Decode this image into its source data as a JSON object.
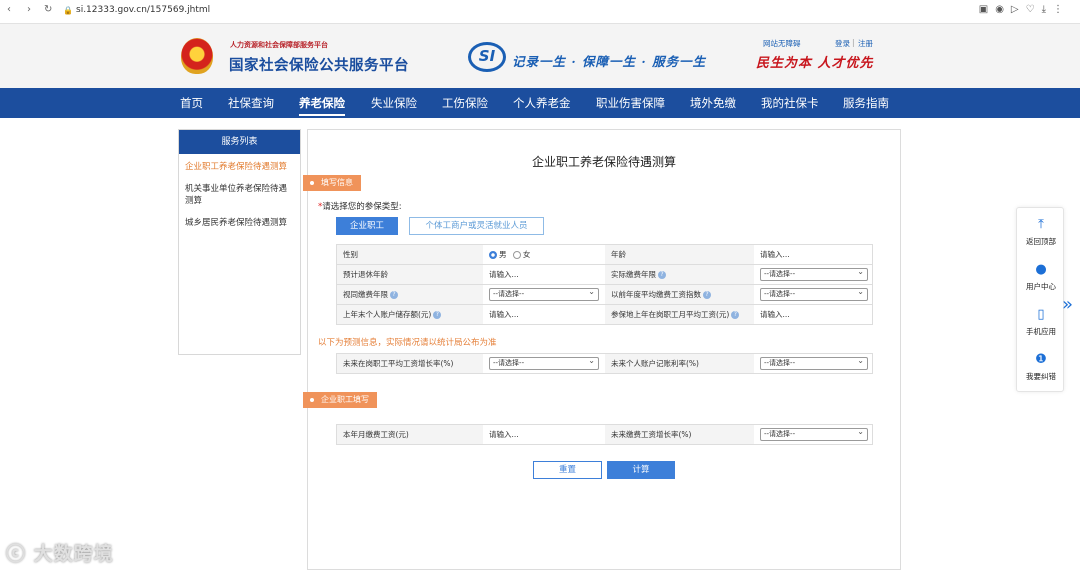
{
  "browser": {
    "url": "si.12333.gov.cn/157569.jhtml"
  },
  "header": {
    "org_sub": "人力资源和社会保障部服务平台",
    "org_main": "国家社会保险公共服务平台",
    "logo_text": "SI",
    "slogan": "记录一生 · 保障一生 · 服务一生",
    "accessibility": "网站无障碍",
    "login": "登录",
    "register": "注册",
    "calligraphy": "民生为本 人才优先"
  },
  "nav": [
    "首页",
    "社保查询",
    "养老保险",
    "失业保险",
    "工伤保险",
    "个人养老金",
    "职业伤害保障",
    "境外免缴",
    "我的社保卡",
    "服务指南"
  ],
  "sidebar": {
    "title": "服务列表",
    "items": [
      "企业职工养老保险待遇测算",
      "机关事业单位养老保险待遇测算",
      "城乡居民养老保险待遇测算"
    ]
  },
  "page": {
    "title": "企业职工养老保险待遇测算",
    "tag_fill": "填写信息",
    "choose_label": "请选择您的参保类型:",
    "type_buttons": [
      "企业职工",
      "个体工商户或灵活就业人员"
    ],
    "note": "以下为预测信息，实际情况请以统计局公布为准",
    "tag_enterprise": "企业职工填写",
    "reset": "重置",
    "calc": "计算"
  },
  "form": {
    "gender": "性别",
    "male": "男",
    "female": "女",
    "age": "年龄",
    "age_ph": "请输入...",
    "retire_age": "预计退休年龄",
    "retire_age_ph": "请输入...",
    "actual_years": "实际缴费年限",
    "actual_years_sel": "--请选择--",
    "deemed_years": "视同缴费年限",
    "deemed_years_sel": "--请选择--",
    "past_index": "以前年度平均缴费工资指数",
    "past_index_sel": "--请选择--",
    "account_balance": "上年末个人账户储存额(元)",
    "account_balance_ph": "请输入...",
    "avg_wage": "参保地上年在岗职工月平均工资(元)",
    "avg_wage_ph": "请输入...",
    "future_wage_growth": "未来在岗职工平均工资增长率(%)",
    "future_wage_growth_sel": "--请选择--",
    "future_interest": "未来个人账户记账利率(%)",
    "future_interest_sel": "--请选择--",
    "monthly_wage": "本年月缴费工资(元)",
    "monthly_wage_ph": "请输入...",
    "future_contrib_growth": "未来缴费工资增长率(%)",
    "future_contrib_growth_sel": "--请选择--"
  },
  "float_bar": [
    "返回顶部",
    "用户中心",
    "手机应用",
    "我要纠错"
  ],
  "watermark": "大数跨境",
  "colors": {
    "brand": "#1c4e9e",
    "accent": "#f0935a",
    "button": "#3d7fd9"
  }
}
